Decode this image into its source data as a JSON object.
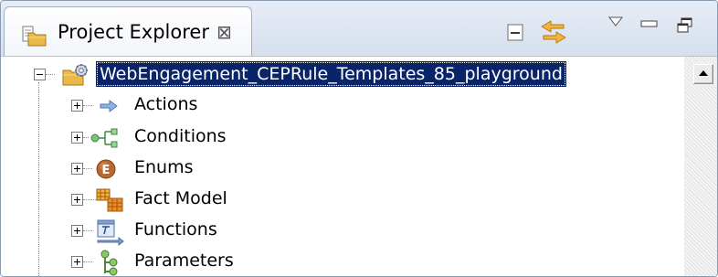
{
  "view": {
    "tab_title": "Project Explorer",
    "tab_close_glyph": "⊠",
    "tab_icon": "project-explorer-folder-icon",
    "toolbar": [
      {
        "name": "collapse-all-button",
        "icon": "collapse-all-icon"
      },
      {
        "name": "link-with-editor-button",
        "icon": "link-with-editor-icon"
      },
      {
        "name": "view-menu-button",
        "icon": "triangle-down-icon"
      },
      {
        "name": "minimize-button",
        "icon": "minimize-icon"
      },
      {
        "name": "maximize-button",
        "icon": "maximize-icon"
      }
    ]
  },
  "tree": {
    "root": {
      "label": "WebEngagement_CEPRule_Templates_85_playground",
      "icon": "project-folder-icon",
      "expanded": true,
      "selected": true
    },
    "children": [
      {
        "label": "Actions",
        "icon": "arrow-right-icon",
        "expanded": false
      },
      {
        "label": "Conditions",
        "icon": "conditions-icon",
        "expanded": false
      },
      {
        "label": "Enums",
        "icon": "enum-e-icon",
        "expanded": false
      },
      {
        "label": "Fact Model",
        "icon": "fact-model-icon",
        "expanded": false
      },
      {
        "label": "Functions",
        "icon": "functions-icon",
        "expanded": false
      },
      {
        "label": "Parameters",
        "icon": "parameters-icon",
        "expanded": false
      }
    ]
  },
  "colors": {
    "selection_bg": "#0a246a",
    "selection_text": "#ffffff",
    "header_bg": "#dde5f1",
    "border": "#8a9bb0"
  }
}
